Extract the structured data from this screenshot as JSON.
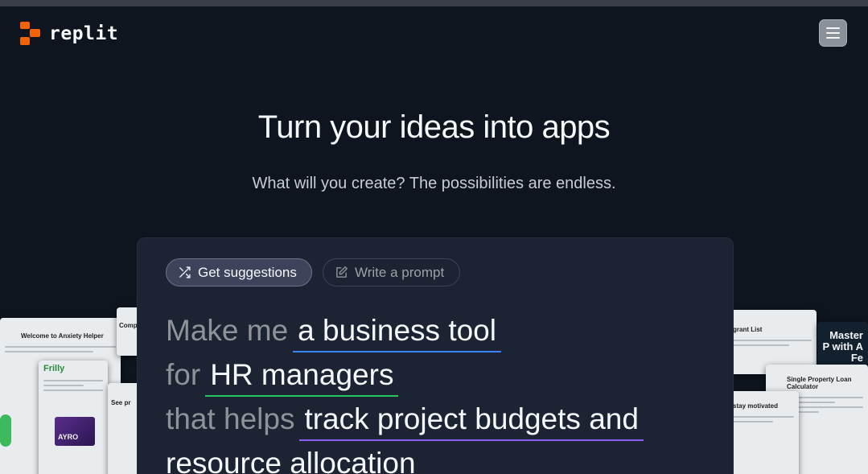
{
  "header": {
    "logo_text": "replit",
    "brand_color": "#f26207",
    "menu_icon": "hamburger-menu-icon"
  },
  "hero": {
    "title": "Turn your ideas into apps",
    "subtitle": "What will you create? The possibilities are endless."
  },
  "prompt": {
    "chips": [
      {
        "label": "Get suggestions",
        "icon": "shuffle-icon",
        "active": true
      },
      {
        "label": "Write a prompt",
        "icon": "edit-icon",
        "active": false
      }
    ],
    "lines": [
      {
        "prefix": "Make me",
        "highlight": "a business tool",
        "underline": "#3b82f6"
      },
      {
        "prefix": "for",
        "highlight": "HR managers",
        "underline": "#22c55e"
      },
      {
        "prefix": "that helps",
        "highlight": "track project budgets and",
        "underline": "#8b5cf6"
      },
      {
        "prefix": "",
        "highlight": "resource allocation",
        "underline": ""
      }
    ]
  },
  "previews": {
    "left": [
      {
        "title": "Welcome to Anxiety Helper"
      },
      {
        "title": "Comp"
      },
      {
        "title": "Frilly"
      },
      {
        "title": "AYRO"
      },
      {
        "title": "See pr"
      }
    ],
    "right": [
      {
        "title": "grant List"
      },
      {
        "title": "Master P with A Fe"
      },
      {
        "title": "Single Property Loan Calculator"
      },
      {
        "title": "stay motivated"
      }
    ]
  }
}
